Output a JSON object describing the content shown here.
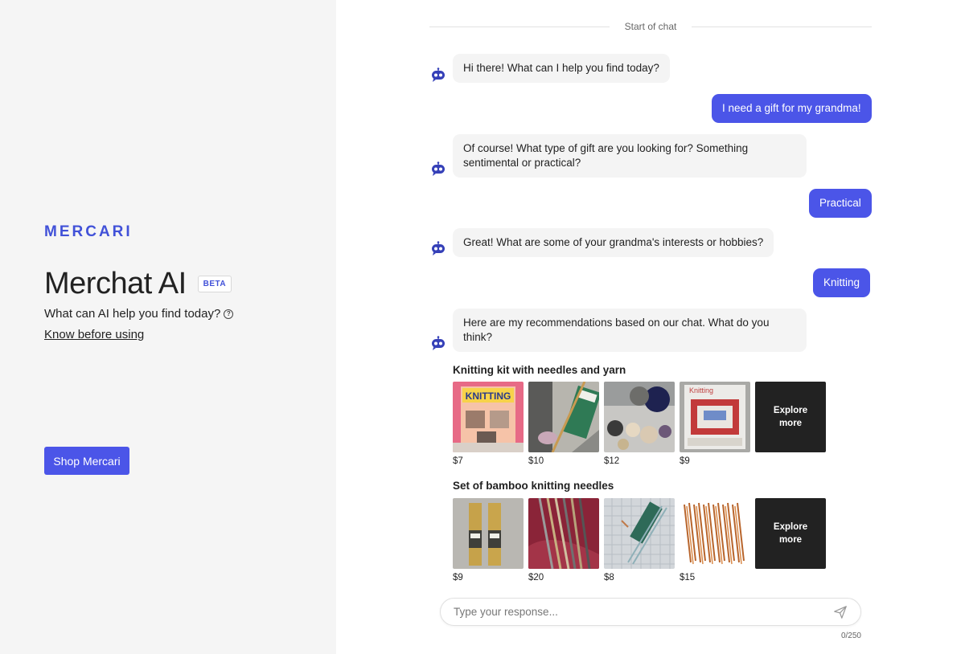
{
  "brand": {
    "logo_text": "MERCARI",
    "accent_color": "#4b55e8",
    "dark_tile_color": "#222222"
  },
  "sidebar": {
    "title": "Merchat AI",
    "badge": "BETA",
    "subtitle": "What can AI help you find today?",
    "help_icon": "question-circle-icon",
    "know_link": "Know before using",
    "shop_button": "Shop Mercari"
  },
  "chat": {
    "divider_text": "Start of chat",
    "messages": [
      {
        "role": "bot",
        "text": "Hi there! What can I help you find today?"
      },
      {
        "role": "user",
        "text": "I need a gift for my grandma!"
      },
      {
        "role": "bot",
        "text": "Of course! What type of gift are you looking for? Something sentimental or practical?"
      },
      {
        "role": "user",
        "text": "Practical"
      },
      {
        "role": "bot",
        "text": "Great! What are some of your grandma's interests or hobbies?"
      },
      {
        "role": "user",
        "text": "Knitting"
      },
      {
        "role": "bot",
        "text": "Here are my recommendations based on our chat. What do you think?"
      }
    ],
    "recommendations": [
      {
        "title": "Knitting kit with needles and yarn",
        "items": [
          {
            "price": "$7",
            "thumb_label": "KNITTING"
          },
          {
            "price": "$10"
          },
          {
            "price": "$12"
          },
          {
            "price": "$9",
            "thumb_label": "Knitting"
          }
        ],
        "explore_label_1": "Explore",
        "explore_label_2": "more"
      },
      {
        "title": "Set of bamboo knitting needles",
        "items": [
          {
            "price": "$9"
          },
          {
            "price": "$20"
          },
          {
            "price": "$8"
          },
          {
            "price": "$15"
          }
        ],
        "explore_label_1": "Explore",
        "explore_label_2": "more"
      }
    ]
  },
  "composer": {
    "placeholder": "Type your response...",
    "value": "",
    "counter": "0/250",
    "send_icon": "paper-plane-icon"
  }
}
